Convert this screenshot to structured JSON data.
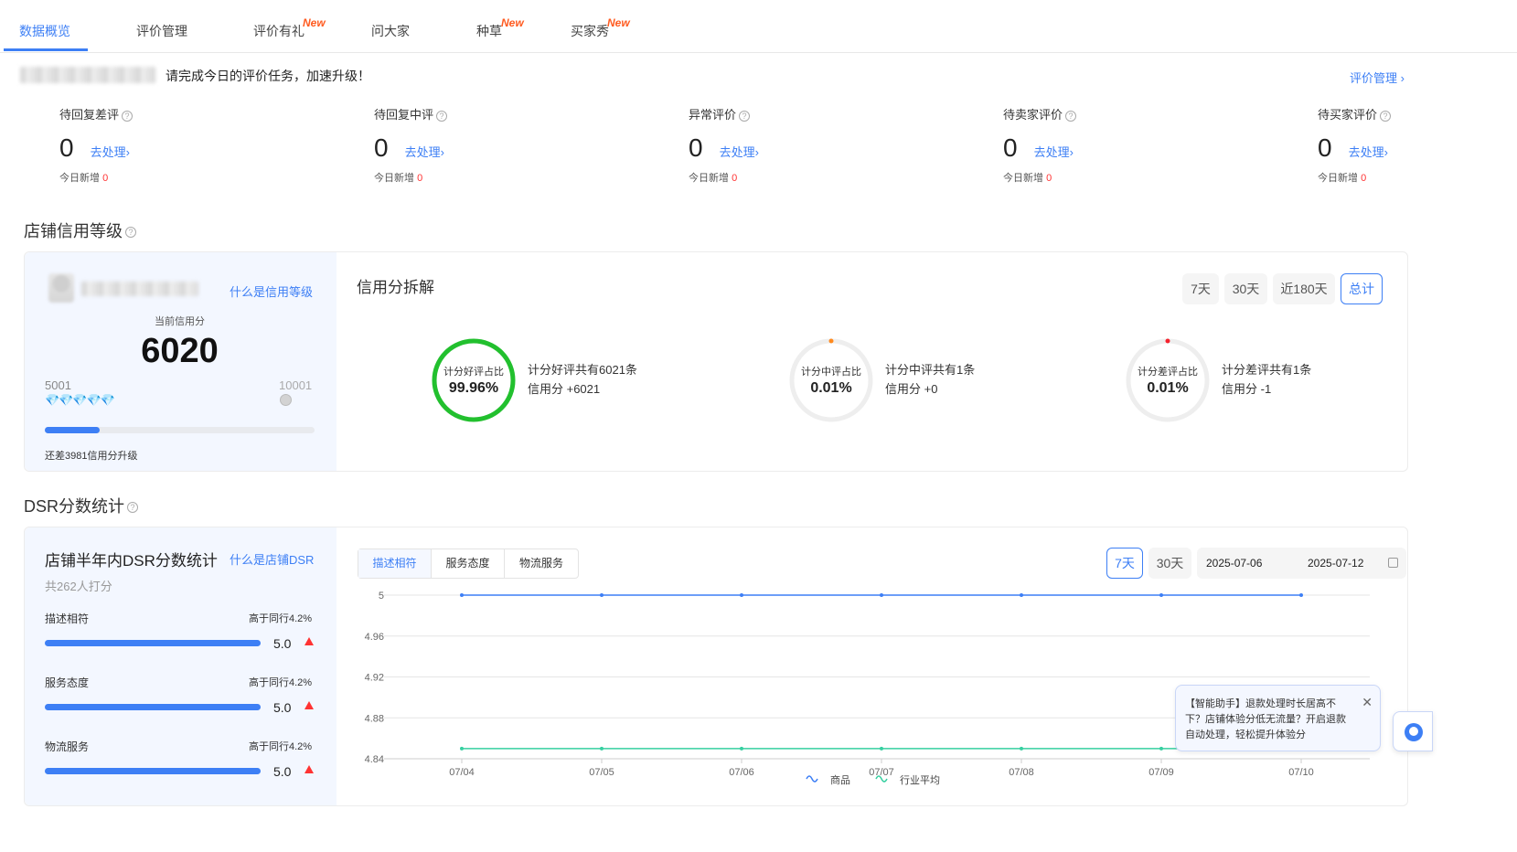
{
  "tabs": [
    {
      "label": "数据概览",
      "new": ""
    },
    {
      "label": "评价管理",
      "new": ""
    },
    {
      "label": "评价有礼",
      "new": "New"
    },
    {
      "label": "问大家",
      "new": ""
    },
    {
      "label": "种草",
      "new": "New"
    },
    {
      "label": "买家秀",
      "new": "New"
    }
  ],
  "notice": {
    "text": "请完成今日的评价任务，加速升级！",
    "link": "评价管理 ›"
  },
  "stats": [
    {
      "label": "待回复差评",
      "value": "0",
      "action": "去处理›",
      "today_label": "今日新增",
      "today_value": "0"
    },
    {
      "label": "待回复中评",
      "value": "0",
      "action": "去处理›",
      "today_label": "今日新增",
      "today_value": "0"
    },
    {
      "label": "异常评价",
      "value": "0",
      "action": "去处理›",
      "today_label": "今日新增",
      "today_value": "0"
    },
    {
      "label": "待卖家评价",
      "value": "0",
      "action": "去处理›",
      "today_label": "今日新增",
      "today_value": "0"
    },
    {
      "label": "待买家评价",
      "value": "0",
      "action": "去处理›",
      "today_label": "今日新增",
      "today_value": "0"
    }
  ],
  "credit": {
    "title": "店铺信用等级",
    "what_link": "什么是信用等级",
    "score_label": "当前信用分",
    "score": "6020",
    "min": "5001",
    "max": "10001",
    "progress": 0.2038,
    "remaining": "还差3981信用分升级",
    "breakdown_title": "信用分拆解",
    "periods": [
      "7天",
      "30天",
      "近180天",
      "总计"
    ],
    "active_period": "总计",
    "rings": [
      {
        "label": "计分好评占比",
        "value": "99.96%",
        "fraction": 0.9996,
        "color": "#22c02e",
        "desc1": "计分好评共有6021条",
        "desc2": "信用分 +6021"
      },
      {
        "label": "计分中评占比",
        "value": "0.01%",
        "fraction": 0.0001,
        "color": "#ff8a1f",
        "desc1": "计分中评共有1条",
        "desc2": "信用分 +0"
      },
      {
        "label": "计分差评占比",
        "value": "0.01%",
        "fraction": 0.0001,
        "color": "#f5222d",
        "desc1": "计分差评共有1条",
        "desc2": "信用分 -1"
      }
    ]
  },
  "dsr": {
    "title": "DSR分数统计",
    "panel_title": "店铺半年内DSR分数统计",
    "what_link": "什么是店铺DSR",
    "raters": "共262人打分",
    "items": [
      {
        "label": "描述相符",
        "compare": "高于同行4.2%",
        "score": "5.0",
        "fraction": 1.0
      },
      {
        "label": "服务态度",
        "compare": "高于同行4.2%",
        "score": "5.0",
        "fraction": 1.0
      },
      {
        "label": "物流服务",
        "compare": "高于同行4.2%",
        "score": "5.0",
        "fraction": 1.0
      }
    ],
    "subtabs": [
      "描述相符",
      "服务态度",
      "物流服务"
    ],
    "active_subtab": "描述相符",
    "periods": [
      "7天",
      "30天"
    ],
    "active_period": "7天",
    "date_start": "2025-07-06",
    "date_end": "2025-07-12"
  },
  "chart_data": {
    "type": "line",
    "x": [
      "07/04",
      "07/05",
      "07/06",
      "07/07",
      "07/08",
      "07/09",
      "07/10"
    ],
    "ylim": [
      4.84,
      5
    ],
    "yticks": [
      "5",
      "4.96",
      "4.92",
      "4.88",
      "4.84"
    ],
    "series": [
      {
        "name": "商品",
        "color": "#3d7ff5",
        "values": [
          5,
          5,
          5,
          5,
          5,
          5,
          5
        ]
      },
      {
        "name": "行业平均",
        "color": "#36cfa0",
        "values": [
          4.85,
          4.85,
          4.85,
          4.85,
          4.85,
          4.85,
          4.85
        ]
      }
    ],
    "grid": true,
    "legend": "bottom"
  },
  "assistant_toast": {
    "text": "【智能助手】退款处理时长居高不下？店铺体验分低无流量？开启退款自动处理，轻松提升体验分"
  }
}
